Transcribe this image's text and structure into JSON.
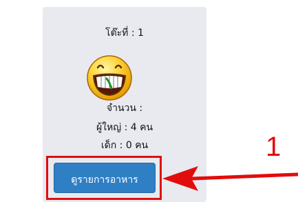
{
  "table": {
    "title": "โต๊ะที่ : 1",
    "count_label": "จำนวน :",
    "adults": "ผู้ใหญ่ : 4 คน",
    "children": "เด็ก : 0 คน",
    "menu_button_label": "ดูรายการอาหาร",
    "emoji_icon": "grinning-face-icon"
  },
  "annotation": {
    "step_number": "1",
    "color": "#e10d0d"
  },
  "colors": {
    "card_background": "#e8eaef",
    "button": "#2f7fc4"
  }
}
